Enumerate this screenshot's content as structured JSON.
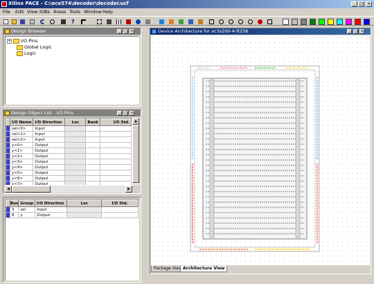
{
  "window": {
    "title": "Xilinx PACE - C:\\ece574\\decoder\\decoder.ucf"
  },
  "menu": [
    "File",
    "Edit",
    "View",
    "IOBs",
    "Areas",
    "Tools",
    "Window",
    "Help"
  ],
  "toolbar": {
    "icons": [
      "new-icon",
      "open-icon",
      "save-icon",
      "print-icon",
      "undo-icon",
      "find-icon",
      "binoculars-icon",
      "help-icon",
      "select-icon",
      "zoom-area-icon",
      "layers-icon",
      "grid-icon",
      "place-icon",
      "pin-icon",
      "bank-icon",
      "table-icon",
      "list-icon",
      "fit-icon",
      "zoom-out-icon",
      "zoom-in-icon",
      "zoom-full-icon",
      "refresh-icon"
    ],
    "swatches": [
      "#ffffff",
      "#c0c0c0",
      "#808080",
      "#008000",
      "#00ff00",
      "#ffff00",
      "#00ffff",
      "#ff00ff",
      "#ff0000",
      "#0000ff"
    ]
  },
  "design_browser": {
    "title": "Design Browser",
    "items": [
      {
        "label": "I/O Pins",
        "expandable": "+"
      },
      {
        "label": "Global Logic",
        "expandable": ""
      },
      {
        "label": "Logic",
        "expandable": ""
      }
    ]
  },
  "object_list": {
    "title": "Design Object List - I/O Pins",
    "columns": [
      "I/O Name",
      "I/O Direction",
      "Loc",
      "Bank",
      "I/O Std."
    ],
    "rows": [
      [
        "sel<0>",
        "Input"
      ],
      [
        "sel<1>",
        "Input"
      ],
      [
        "sel<2>",
        "Input"
      ],
      [
        "y<0>",
        "Output"
      ],
      [
        "y<1>",
        "Output"
      ],
      [
        "y<2>",
        "Output"
      ],
      [
        "y<3>",
        "Output"
      ],
      [
        "y<4>",
        "Output"
      ],
      [
        "y<5>",
        "Output"
      ],
      [
        "y<6>",
        "Output"
      ],
      [
        "y<7>",
        "Output"
      ]
    ]
  },
  "group_list": {
    "columns": [
      "Bus",
      "Group",
      "I/O Direction",
      "Loc",
      "I/O Std."
    ],
    "rows": [
      [
        "3",
        "sel",
        "Input"
      ],
      [
        "8",
        "y",
        "Output"
      ]
    ]
  },
  "architecture": {
    "title": "Device Architecture for xc3s200-4-ft256",
    "tabs": [
      "Package View",
      "Architecture View"
    ]
  }
}
